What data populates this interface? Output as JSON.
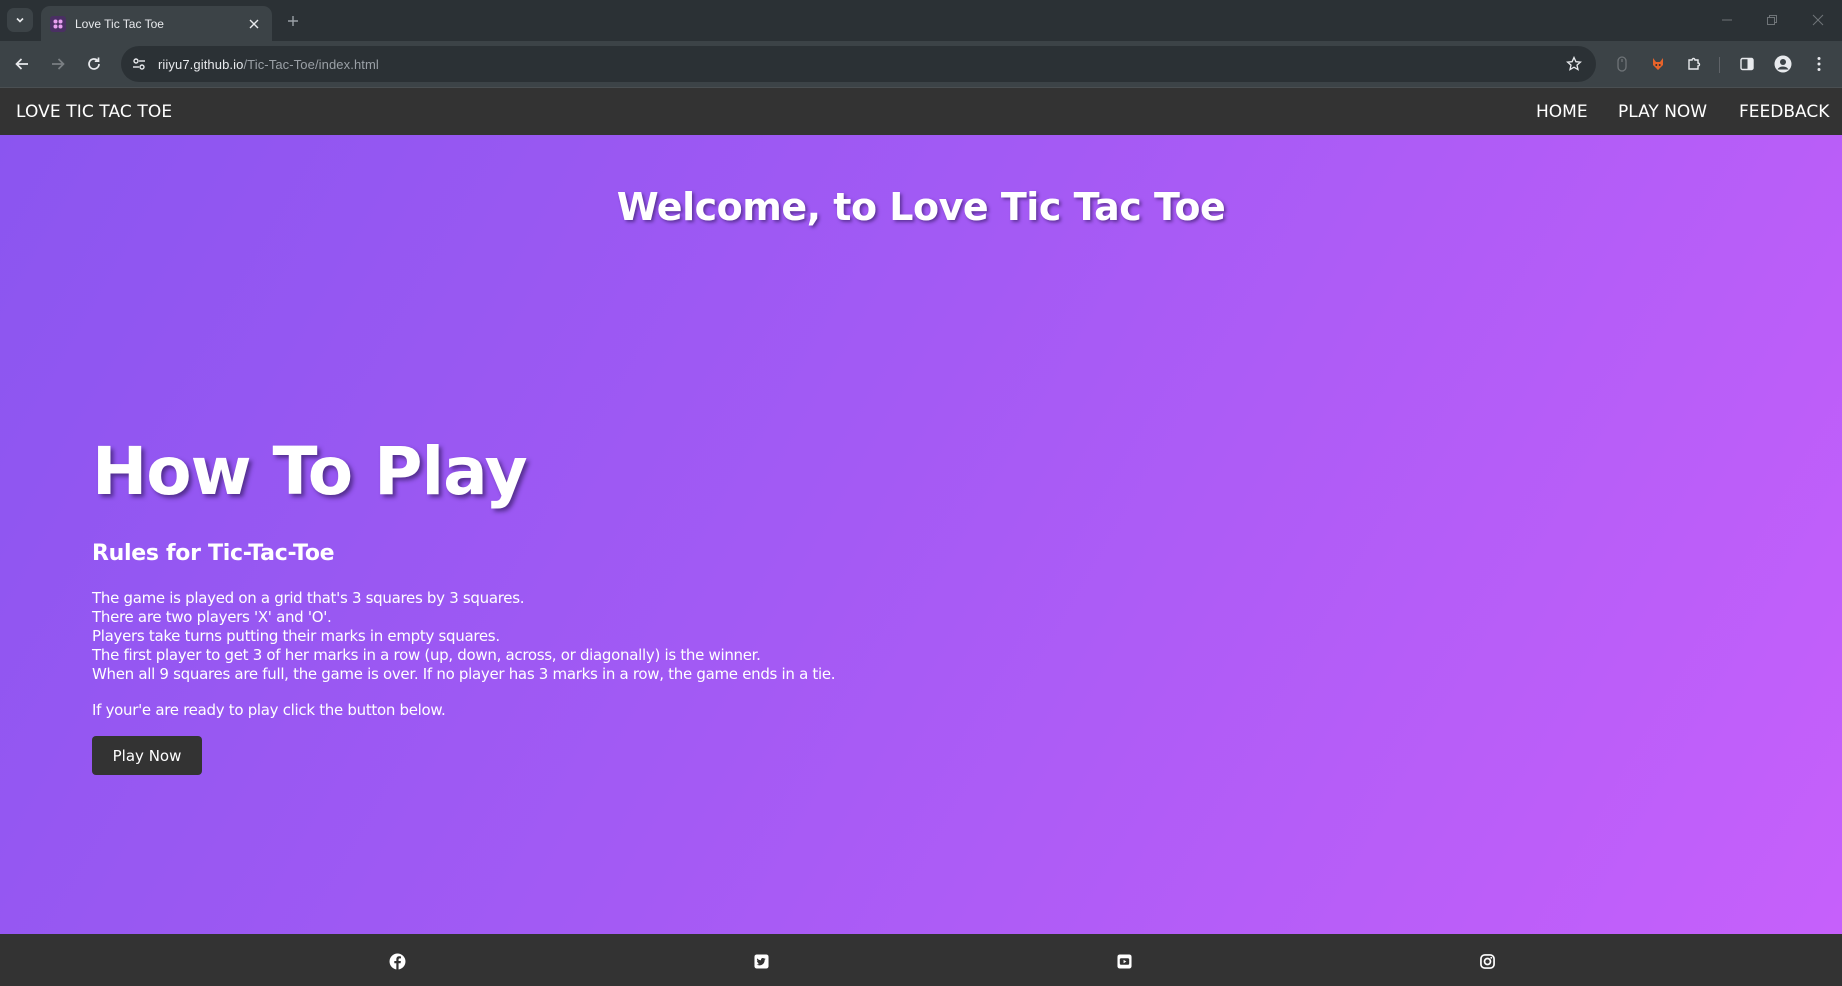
{
  "browser": {
    "tab": {
      "title": "Love Tic Tac Toe"
    },
    "url": {
      "host": "riiyu7.github.io",
      "path": "/Tic-Tac-Toe/index.html"
    }
  },
  "site": {
    "nav": {
      "brand": "LOVE TIC TAC TOE",
      "links": [
        "HOME",
        "PLAY NOW",
        "FEEDBACK"
      ]
    },
    "hero": {
      "welcome": "Welcome, to Love Tic Tac Toe",
      "how_to_play": "How To Play",
      "rules_title": "Rules for Tic-Tac-Toe",
      "rules": [
        "The game is played on a grid that's 3 squares by 3 squares.",
        "There are two players 'X' and 'O'.",
        "Players take turns putting their marks in empty squares.",
        "The first player to get 3 of her marks in a row (up, down, across, or diagonally) is the winner.",
        "When all 9 squares are full, the game is over. If no player has 3 marks in a row, the game ends in a tie."
      ],
      "ready_text": "If your'e are ready to play click the button below.",
      "play_button": "Play Now"
    },
    "footer": {
      "icons": [
        "facebook-icon",
        "twitter-icon",
        "youtube-icon",
        "instagram-icon"
      ]
    }
  },
  "colors": {
    "gradient_start": "#8b55f0",
    "gradient_end": "#c660fb",
    "nav_bg": "#333333",
    "chrome_bg": "#2b3135"
  }
}
